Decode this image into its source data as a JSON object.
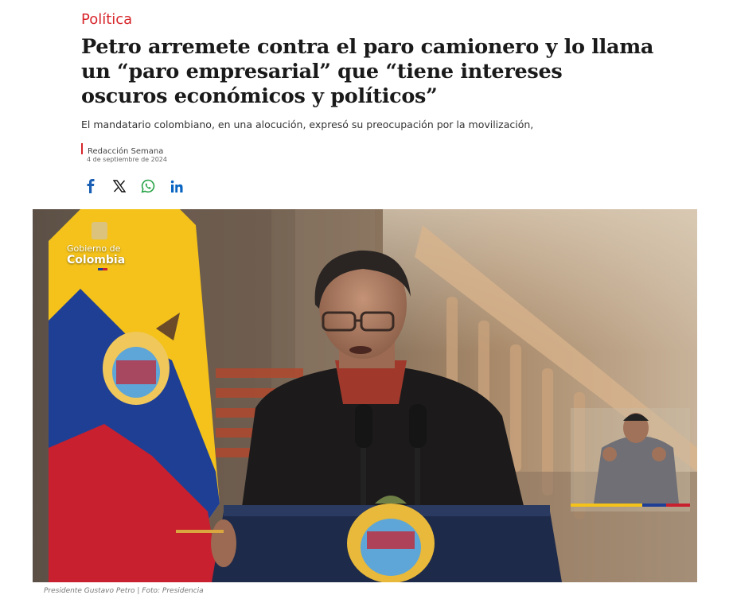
{
  "article": {
    "section": "Política",
    "headline": "Petro arremete contra el paro camionero y lo llama un “paro empresarial” que “tiene intereses oscuros económicos y políticos”",
    "lead": "El mandatario colombiano, en una alocución, expresó su preocupación por la movilización,",
    "author": "Redacción Semana",
    "date": "4 de septiembre de 2024"
  },
  "share": [
    {
      "name": "facebook",
      "icon": "facebook-icon",
      "color": "#1a5fb4"
    },
    {
      "name": "x",
      "icon": "x-icon",
      "color": "#111111"
    },
    {
      "name": "whatsapp",
      "icon": "whatsapp-icon",
      "color": "#25a244"
    },
    {
      "name": "linkedin",
      "icon": "linkedin-icon",
      "color": "#0a66c2"
    }
  ],
  "photo": {
    "logo_line1": "Gobierno de",
    "logo_line2": "Colombia",
    "caption": "Presidente Gustavo Petro | Foto: Presidencia"
  },
  "colors": {
    "accent": "#d7262b",
    "flag_yellow": "#f4c21a",
    "flag_blue": "#1f3f95",
    "flag_red": "#c8202e"
  }
}
